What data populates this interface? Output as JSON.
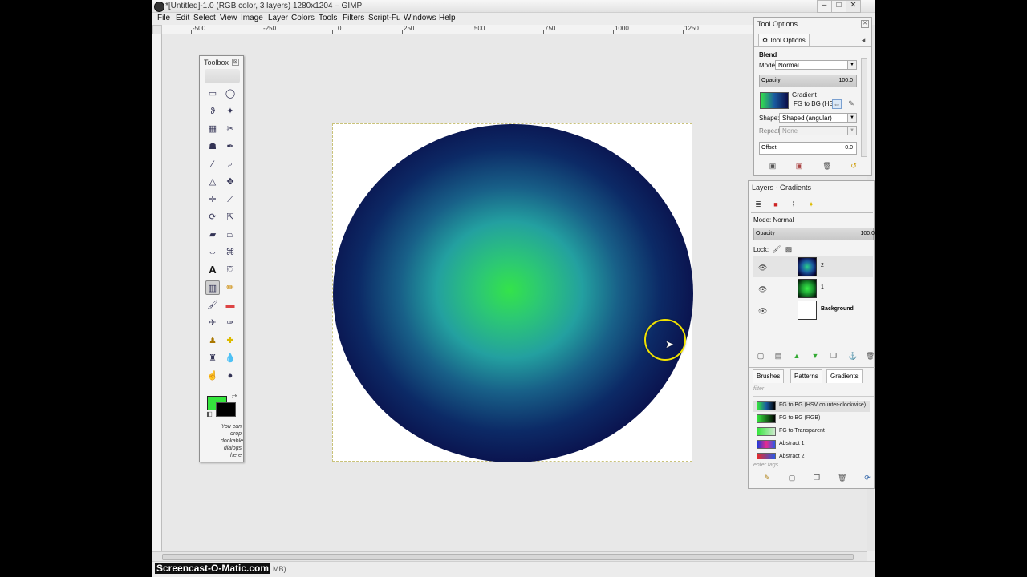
{
  "window": {
    "title": "*[Untitled]-1.0 (RGB color, 3 layers) 1280x1204 – GIMP",
    "controls": [
      "–",
      "□",
      "✕"
    ]
  },
  "menu": [
    "File",
    "Edit",
    "Select",
    "View",
    "Image",
    "Layer",
    "Colors",
    "Tools",
    "Filters",
    "Script-Fu",
    "Windows",
    "Help"
  ],
  "ruler": {
    "labels": [
      "-500",
      "-250",
      "0",
      "250",
      "500",
      "750",
      "1000",
      "1250"
    ]
  },
  "status": {
    "text": "MB)"
  },
  "toolbox": {
    "title": "Toolbox",
    "close": "⊠",
    "drop_hint": "You can drop dockable dialogs here",
    "fg_color": "#35e63d",
    "bg_color": "#000000"
  },
  "tool_options": {
    "title": "Tool Options",
    "tab": "Tool Options",
    "tool_name": "Blend",
    "mode_label": "Mode:",
    "mode_value": "Normal",
    "opacity_label": "Opacity",
    "opacity_value": "100.0",
    "gradient_label": "Gradient",
    "gradient_value": "FG to BG (HS",
    "shape_label": "Shape:",
    "shape_value": "Shaped (angular)",
    "repeat_label": "Repeat:",
    "repeat_value": "None",
    "offset_label": "Offset",
    "offset_value": "0.0"
  },
  "layers": {
    "title": "Layers - Gradients",
    "mode_label": "Mode: Normal",
    "opacity_label": "Opacity",
    "opacity_value": "100.0",
    "lock_label": "Lock:",
    "items": [
      {
        "name": "2",
        "selected": true
      },
      {
        "name": "1",
        "selected": false
      },
      {
        "name": "Background",
        "selected": false
      }
    ]
  },
  "gradients_panel": {
    "tabs": [
      "Brushes",
      "Patterns",
      "Gradients"
    ],
    "filter_placeholder": "filter",
    "tags_placeholder": "enter tags",
    "items": [
      "FG to BG (HSV counter-clockwise)",
      "FG to BG (RGB)",
      "FG to Transparent",
      "Abstract 1",
      "Abstract 2"
    ]
  },
  "watermark": "Screencast-O-Matic.com"
}
